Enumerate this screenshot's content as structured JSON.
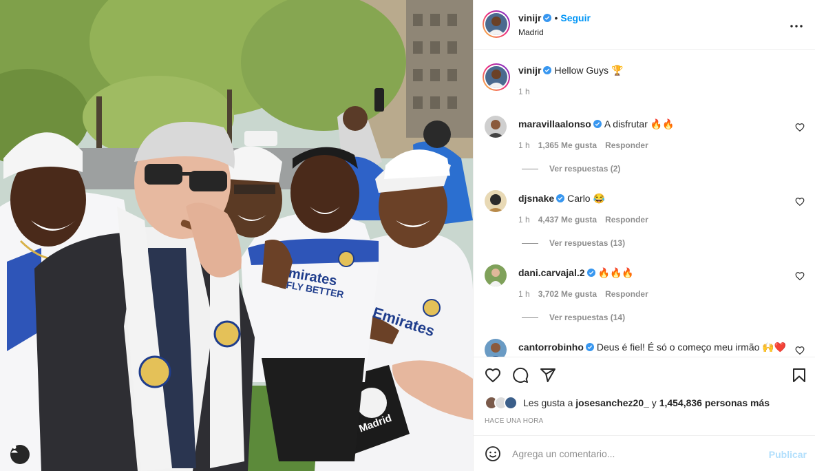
{
  "post": {
    "author": "vinijr",
    "location": "Madrid",
    "follow_label": "Seguir",
    "dot": "•",
    "more_icon": "more-horizontal-icon"
  },
  "caption": {
    "username": "vinijr",
    "text": "Hellow Guys 🏆",
    "time": "1 h"
  },
  "comments": [
    {
      "username": "maravillaalonso",
      "text": "A disfrutar 🔥🔥",
      "time": "1 h",
      "likes": "1,365 Me gusta",
      "reply": "Responder",
      "replies": "Ver respuestas (2)"
    },
    {
      "username": "djsnake",
      "text": "Carlo 😂",
      "time": "1 h",
      "likes": "4,437 Me gusta",
      "reply": "Responder",
      "replies": "Ver respuestas (13)"
    },
    {
      "username": "dani.carvajal.2",
      "text": "🔥🔥🔥",
      "time": "1 h",
      "likes": "3,702 Me gusta",
      "reply": "Responder",
      "replies": "Ver respuestas (14)"
    },
    {
      "username": "cantorrobinho",
      "text": "Deus é fiel! É só o começo meu irmão 🙌❤️",
      "time": "",
      "likes": "",
      "reply": "",
      "replies": ""
    }
  ],
  "actions": {
    "like_icon": "heart-icon",
    "comment_icon": "comment-icon",
    "share_icon": "send-icon",
    "save_icon": "bookmark-icon"
  },
  "likes": {
    "prefix": "Les gusta a",
    "user": "josesanchez20_",
    "joiner": "y",
    "count": "1,454,836 personas más"
  },
  "timestamp": "HACE UNA HORA",
  "composer": {
    "placeholder": "Agrega un comentario...",
    "publish_label": "Publicar",
    "emoji_icon": "smiley-icon"
  },
  "colors": {
    "accent": "#0095f6",
    "verified": "#3897f0",
    "publish_disabled": "#b2dffc",
    "muted": "#8e8e8e"
  }
}
